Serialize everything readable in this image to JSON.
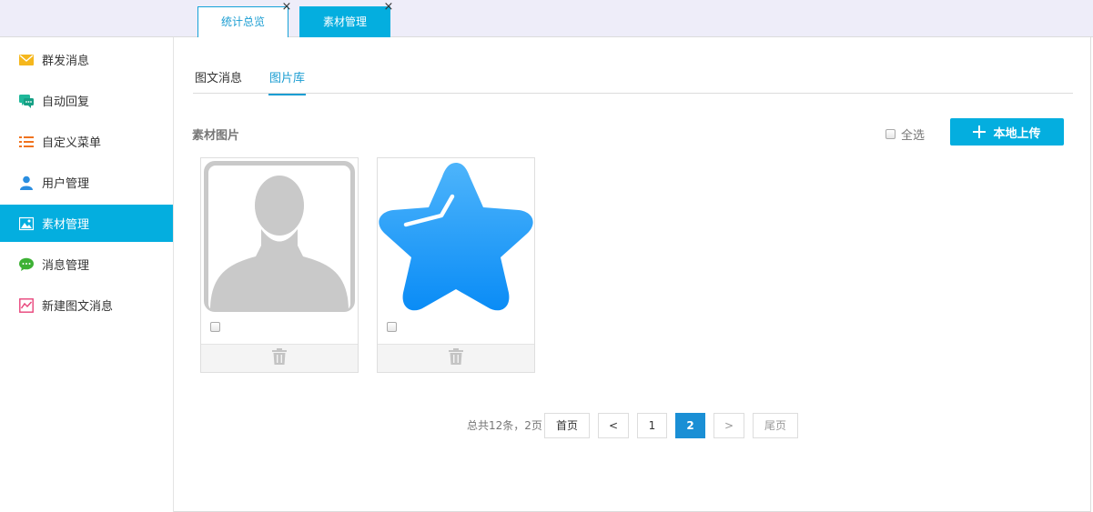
{
  "tabs": [
    {
      "label": "统计总览",
      "close": "×"
    },
    {
      "label": "素材管理",
      "close": "×"
    }
  ],
  "sidebar": {
    "items": [
      {
        "label": "群发消息",
        "icon": "envelope-icon",
        "color": "#f5b71d"
      },
      {
        "label": "自动回复",
        "icon": "chat-bubbles-icon",
        "color": "#1fb89a"
      },
      {
        "label": "自定义菜单",
        "icon": "list-icon",
        "color": "#f0731e"
      },
      {
        "label": "用户管理",
        "icon": "user-icon",
        "color": "#2a8ee0"
      },
      {
        "label": "素材管理",
        "icon": "image-icon",
        "color": "#ffffff",
        "active": true
      },
      {
        "label": "消息管理",
        "icon": "speech-bubble-icon",
        "color": "#3db135"
      },
      {
        "label": "新建图文消息",
        "icon": "chart-frame-icon",
        "color": "#e8437a"
      }
    ]
  },
  "subtabs": [
    {
      "label": "图文消息"
    },
    {
      "label": "图片库",
      "active": true
    }
  ],
  "section": {
    "title": "素材图片",
    "select_all": "全选",
    "upload": "本地上传",
    "upload_icon": "plus-icon"
  },
  "cards": [
    {
      "thumb": "avatar-placeholder-icon",
      "delete_icon": "trash-icon"
    },
    {
      "thumb": "star-clock-icon",
      "delete_icon": "trash-icon"
    }
  ],
  "pagination": {
    "info": "总共12条，2页",
    "first": "首页",
    "prev": "<",
    "pages": [
      "1",
      "2"
    ],
    "current": "2",
    "next": ">",
    "last": "尾页"
  },
  "colors": {
    "accent": "#04aedf",
    "link": "#1a9dd2",
    "page_active": "#1a8fd5",
    "topbar_bg": "#eeedf9"
  }
}
